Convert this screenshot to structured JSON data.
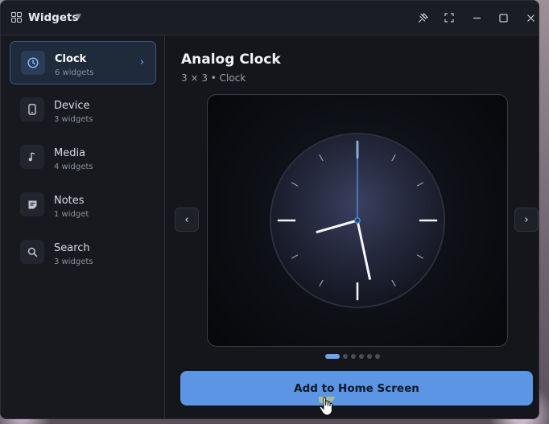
{
  "window": {
    "title": "Widgets",
    "title_icon": "grid-icon",
    "controls": [
      "pin-icon",
      "fullscreen-icon",
      "minimize-icon",
      "maximize-icon",
      "close-icon"
    ]
  },
  "sidebar": {
    "items": [
      {
        "label": "Clock",
        "count": "6 widgets",
        "icon": "clock-icon",
        "active": true
      },
      {
        "label": "Device",
        "count": "3 widgets",
        "icon": "phone-icon",
        "active": false
      },
      {
        "label": "Media",
        "count": "4 widgets",
        "icon": "music-note-icon",
        "active": false
      },
      {
        "label": "Notes",
        "count": "1 widget",
        "icon": "note-icon",
        "active": false
      },
      {
        "label": "Search",
        "count": "3 widgets",
        "icon": "search-icon",
        "active": false
      }
    ]
  },
  "main": {
    "title": "Analog Clock",
    "meta": "3 × 3  •  Clock",
    "clock": {
      "hours": 8,
      "minutes": 28,
      "seconds": 0
    },
    "pager": {
      "total": 6,
      "current": 1
    },
    "add_button_label": "Add to Home Screen"
  },
  "colors": {
    "accent": "#5b95e3",
    "window_bg": "#14161c",
    "sidebar_bg": "#17191f",
    "active_item_bg": "#1f2a3b"
  }
}
